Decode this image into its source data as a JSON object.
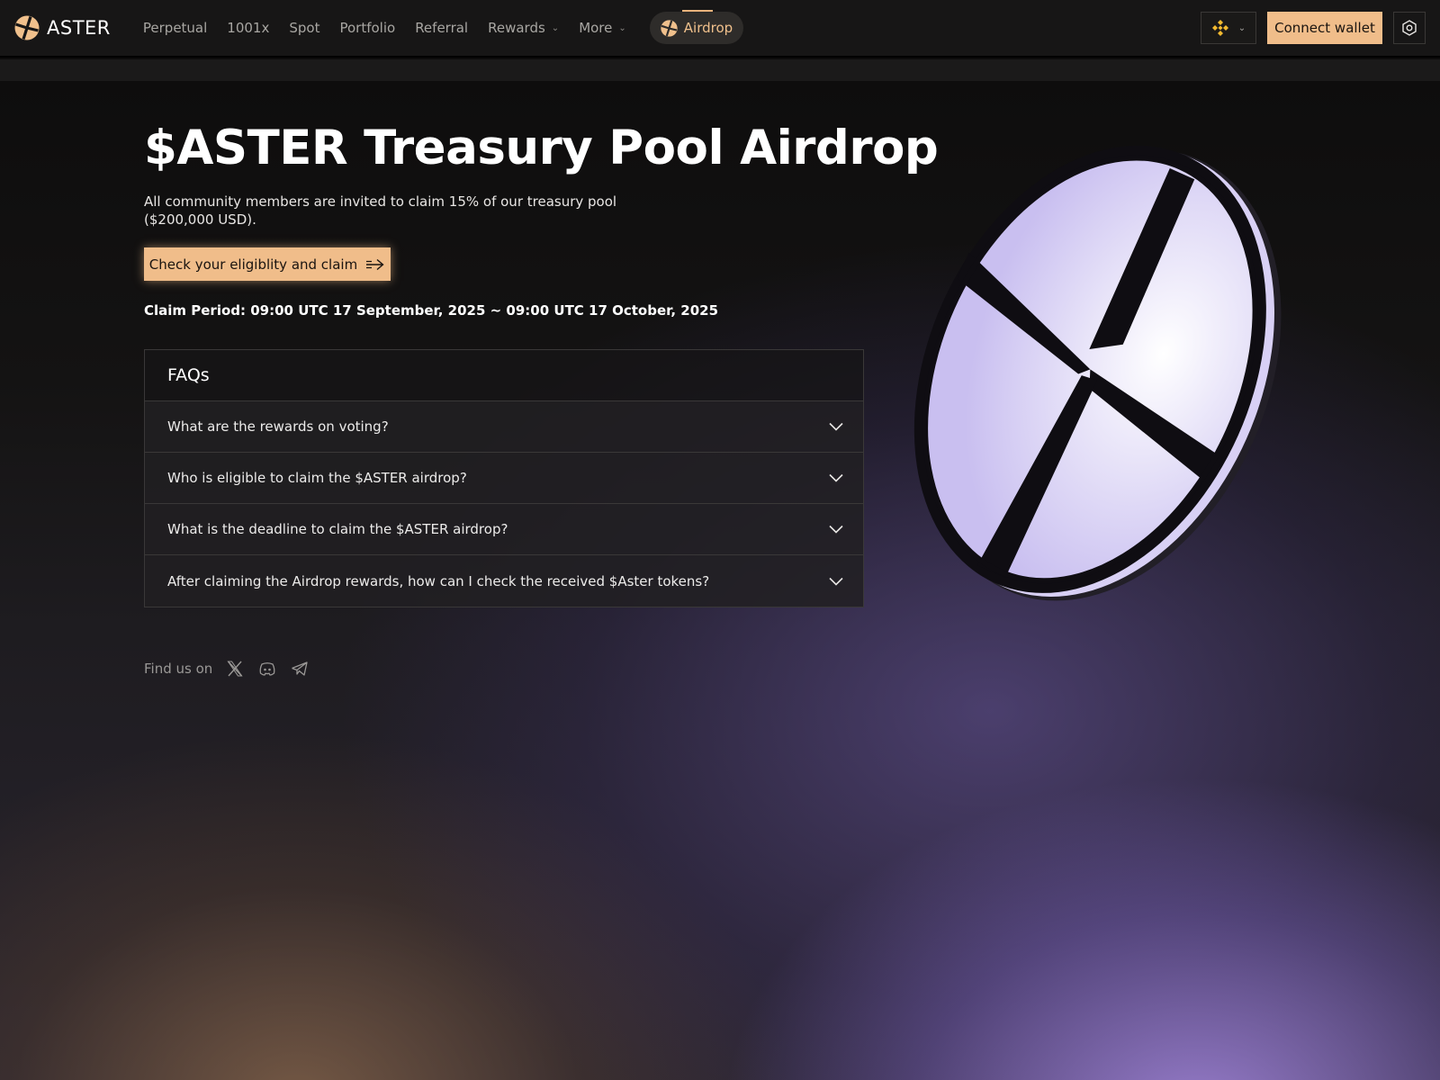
{
  "brand": {
    "name": "ASTER",
    "logo_icon": "aster-logo-icon",
    "accent": "#f0bd8a"
  },
  "nav": {
    "items": [
      {
        "label": "Perpetual"
      },
      {
        "label": "1001x"
      },
      {
        "label": "Spot"
      },
      {
        "label": "Portfolio"
      },
      {
        "label": "Referral"
      },
      {
        "label": "Rewards",
        "has_dropdown": true
      },
      {
        "label": "More",
        "has_dropdown": true
      }
    ],
    "airdrop_label": "Airdrop",
    "chain_icon": "bnb-chain-icon",
    "connect_label": "Connect wallet",
    "settings_icon": "settings-icon"
  },
  "hero": {
    "title": "$ASTER Treasury Pool Airdrop",
    "subtitle": "All community members are invited to claim 15% of our treasury pool ($200,000 USD).",
    "cta_label": "Check your eligiblity and claim",
    "cta_icon": "arrow-right-icon",
    "claim_period": "Claim Period: 09:00 UTC 17 September, 2025 ~ 09:00 UTC 17 October, 2025"
  },
  "faq": {
    "title": "FAQs",
    "items": [
      {
        "question": "What are the rewards on voting?"
      },
      {
        "question": "Who is eligible to claim the $ASTER airdrop?"
      },
      {
        "question": "What is the deadline to claim the $ASTER airdrop?"
      },
      {
        "question": "After claiming the Airdrop rewards, how can I check the received $Aster tokens?"
      }
    ]
  },
  "footer": {
    "find_us_label": "Find us on",
    "socials": [
      "x-icon",
      "discord-icon",
      "telegram-icon"
    ]
  }
}
